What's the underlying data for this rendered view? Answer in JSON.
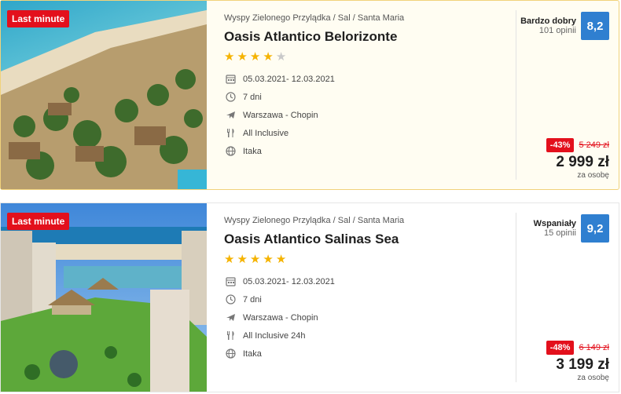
{
  "offers": [
    {
      "badge": "Last minute",
      "location": "Wyspy Zielonego Przylądka / Sal / Santa Maria",
      "name": "Oasis Atlantico Belorizonte",
      "stars": 4,
      "dates": "05.03.2021- 12.03.2021",
      "duration": "7 dni",
      "departure": "Warszawa - Chopin",
      "board": "All Inclusive",
      "operator": "Itaka",
      "rating_label": "Bardzo dobry",
      "reviews": "101 opinii",
      "score": "8,2",
      "discount": "-43%",
      "old_price": "5 249 zł",
      "price": "2 999 zł",
      "per_person": "za osobę"
    },
    {
      "badge": "Last minute",
      "location": "Wyspy Zielonego Przylądka / Sal / Santa Maria",
      "name": "Oasis Atlantico Salinas Sea",
      "stars": 5,
      "dates": "05.03.2021- 12.03.2021",
      "duration": "7 dni",
      "departure": "Warszawa - Chopin",
      "board": "All Inclusive 24h",
      "operator": "Itaka",
      "rating_label": "Wspaniały",
      "reviews": "15 opinii",
      "score": "9,2",
      "discount": "-48%",
      "old_price": "6 149 zł",
      "price": "3 199 zł",
      "per_person": "za osobę"
    }
  ],
  "colors": {
    "accent_red": "#e3101c",
    "score_blue": "#2f7fd0",
    "star": "#f5b301"
  },
  "icons": [
    "calendar-icon",
    "clock-icon",
    "plane-icon",
    "cutlery-icon",
    "globe-icon"
  ]
}
